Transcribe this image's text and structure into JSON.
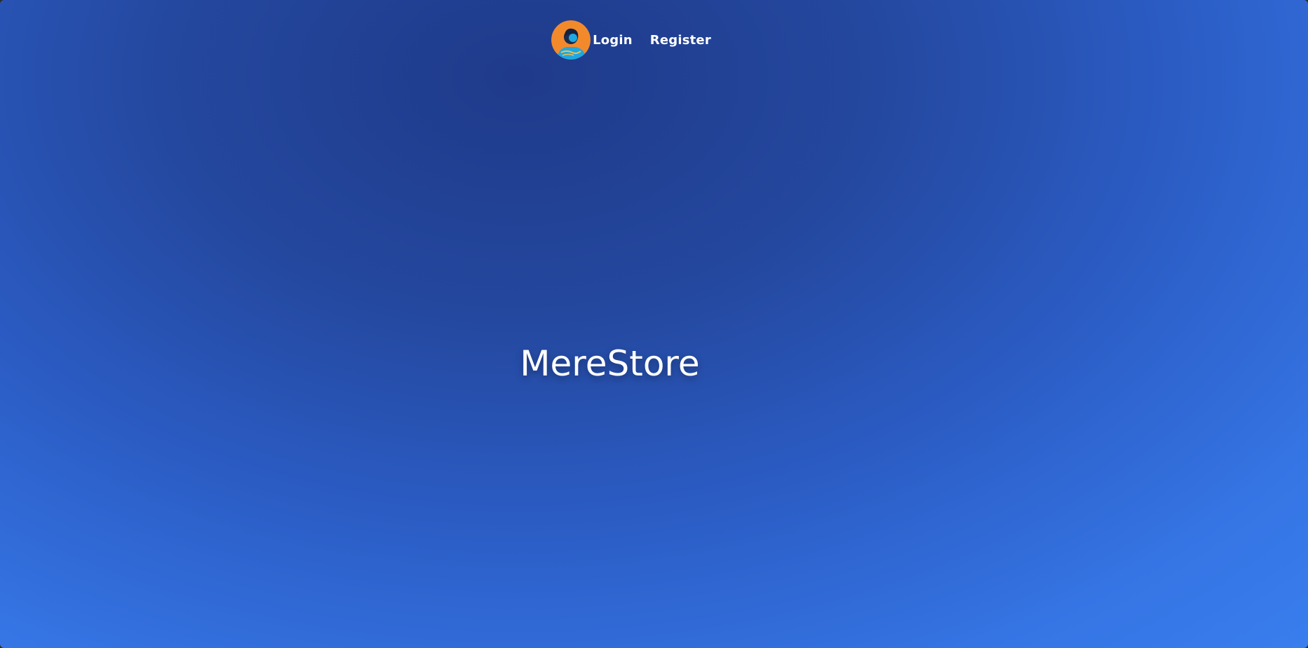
{
  "nav": {
    "avatar_icon": "user-avatar-icon",
    "login_label": "Login",
    "register_label": "Register"
  },
  "hero": {
    "title": "MereStore"
  },
  "colors": {
    "background_dark": "#1f3a8a",
    "background_light": "#3a7ff0",
    "avatar_orange": "#f28a2c",
    "avatar_cyan": "#1fa8e0",
    "text": "#ffffff"
  }
}
